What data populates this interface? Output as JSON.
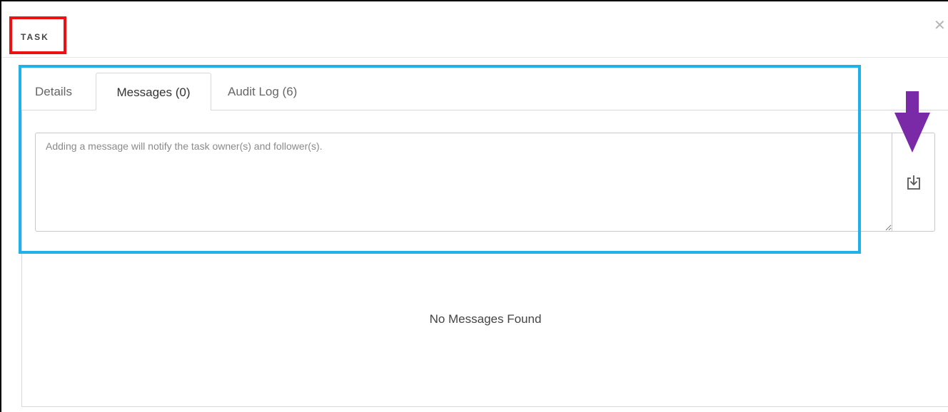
{
  "modal": {
    "title": "TASK",
    "close_icon": "close-icon"
  },
  "tabs": [
    {
      "label": "Details",
      "active": false
    },
    {
      "label": "Messages (0)",
      "active": true
    },
    {
      "label": "Audit Log (6)",
      "active": false
    }
  ],
  "message_form": {
    "placeholder": "Adding a message will notify the task owner(s) and follower(s).",
    "value": "",
    "submit_icon": "download-tray-icon"
  },
  "messages": {
    "empty_text": "No Messages Found"
  },
  "annotations": {
    "title_highlight_color": "#ee1111",
    "tabs_highlight_color": "#1fb2ea",
    "arrow_color": "#7a2aa6",
    "arrow_icon": "down-arrow-icon"
  }
}
